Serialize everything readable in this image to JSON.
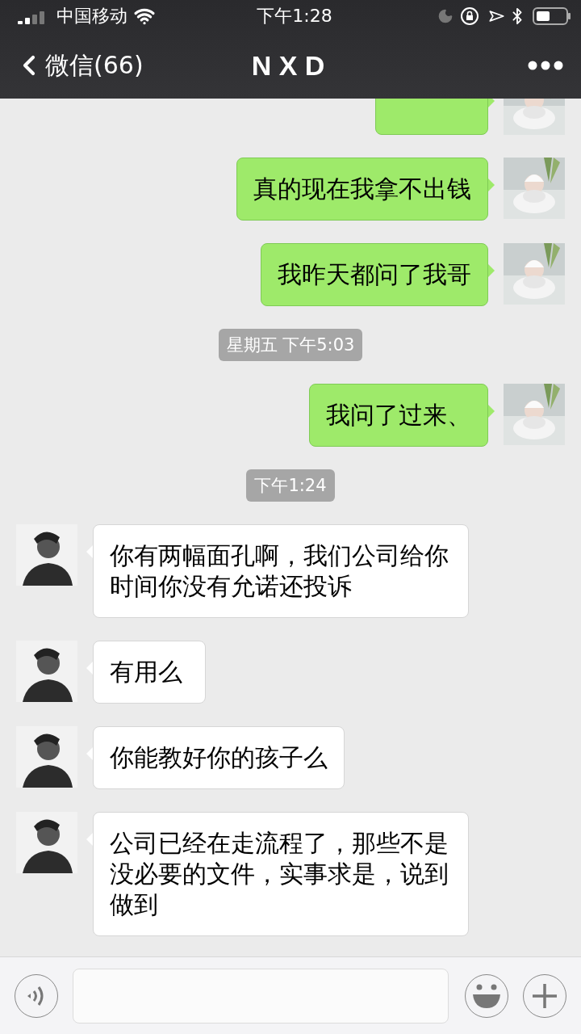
{
  "status_bar": {
    "carrier": "中国移动",
    "time": "下午1:28"
  },
  "nav": {
    "back_label": "微信(66)",
    "title": "N X D"
  },
  "messages": [
    {
      "kind": "sent"
    },
    {
      "kind": "sent",
      "text": "真的现在我拿不出钱"
    },
    {
      "kind": "sent",
      "text": "我昨天都问了我哥"
    },
    {
      "kind": "time",
      "text": "星期五 下午5:03"
    },
    {
      "kind": "sent",
      "text": "我问了过来、"
    },
    {
      "kind": "time",
      "text": "下午1:24"
    },
    {
      "kind": "received",
      "text": "你有两幅面孔啊，我们公司给你时间你没有允诺还投诉"
    },
    {
      "kind": "received",
      "text": "有用么"
    },
    {
      "kind": "received",
      "text": "你能教好你的孩子么"
    },
    {
      "kind": "received",
      "text": "公司已经在走流程了，那些不是没必要的文件，实事求是，说到做到"
    }
  ]
}
